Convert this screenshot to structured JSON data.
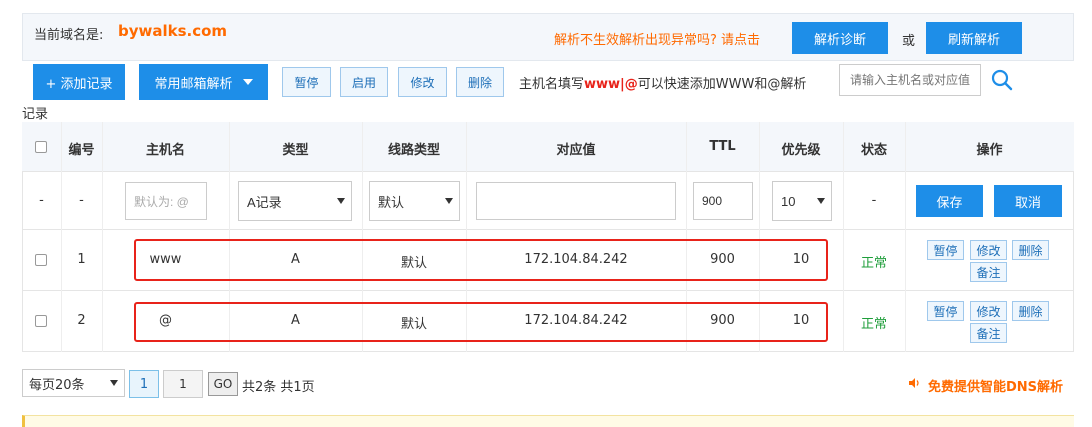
{
  "domain": {
    "label": "当前域名是:",
    "value": "bywalks.com"
  },
  "help_link": "解析不生效解析出现异常吗? 请点击",
  "diagnose_label": "解析诊断",
  "or_label": "或",
  "refresh_label": "刷新解析",
  "toolbar": {
    "add_label": "+ 添加记录",
    "mail_label": "常用邮箱解析",
    "pause_label": "暂停",
    "enable_label": "启用",
    "modify_label": "修改",
    "delete_label": "删除",
    "hint_prefix": "主机名填写",
    "hint_red": "www|@",
    "hint_suffix": "可以快速添加WWW和@解析",
    "hint_cont": "记录",
    "search_placeholder": "请输入主机名或对应值"
  },
  "columns": [
    "编号",
    "主机名",
    "类型",
    "线路类型",
    "对应值",
    "TTL",
    "优先级",
    "状态",
    "操作"
  ],
  "new_row": {
    "index": "-",
    "num": "-",
    "host_placeholder": "默认为: @",
    "type": "A记录",
    "line": "默认",
    "value": "",
    "ttl": "900",
    "priority": "10",
    "status": "-",
    "save_label": "保存",
    "cancel_label": "取消"
  },
  "rows": [
    {
      "num": "1",
      "host": "www",
      "type": "A",
      "line": "默认",
      "value": "172.104.84.242",
      "ttl": "900",
      "priority": "10",
      "status": "正常"
    },
    {
      "num": "2",
      "host": "@",
      "type": "A",
      "line": "默认",
      "value": "172.104.84.242",
      "ttl": "900",
      "priority": "10",
      "status": "正常"
    }
  ],
  "row_actions": {
    "pause": "暂停",
    "modify": "修改",
    "delete": "删除",
    "note": "备注"
  },
  "pagination": {
    "page_size": "每页20条",
    "current_page": "1",
    "page_input": "1",
    "go_label": "GO",
    "total": "共2条 共1页"
  },
  "promo": "免费提供智能DNS解析",
  "colors": {
    "accent": "#1e8ee8",
    "orange": "#ff6a00",
    "highlight": "#e8231a",
    "status_ok": "#1e9e3a"
  }
}
